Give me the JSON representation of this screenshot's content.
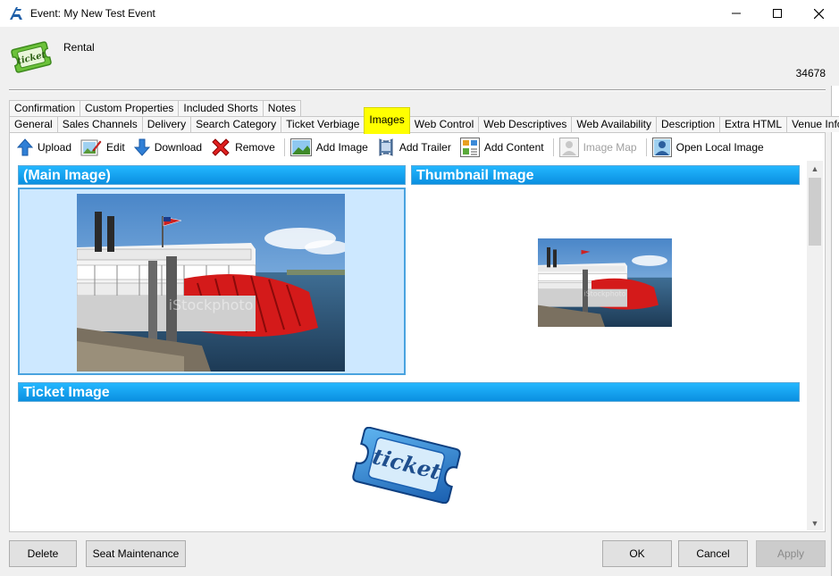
{
  "window": {
    "title": "Event: My New Test Event",
    "controls": {
      "minimize_icon": "minimize-icon",
      "maximize_icon": "maximize-icon",
      "close_icon": "close-icon"
    }
  },
  "header": {
    "type": "Rental",
    "record_id": "34678",
    "icon": "ticket-icon"
  },
  "tabs": {
    "row1": [
      {
        "label": "Confirmation"
      },
      {
        "label": "Custom Properties"
      },
      {
        "label": "Included Shorts"
      },
      {
        "label": "Notes"
      }
    ],
    "row2": [
      {
        "label": "General"
      },
      {
        "label": "Sales Channels"
      },
      {
        "label": "Delivery"
      },
      {
        "label": "Search Category"
      },
      {
        "label": "Ticket Verbiage"
      },
      {
        "label": "Images",
        "active": true
      },
      {
        "label": "Web Control"
      },
      {
        "label": "Web Descriptives"
      },
      {
        "label": "Web Availability"
      },
      {
        "label": "Description"
      },
      {
        "label": "Extra HTML"
      },
      {
        "label": "Venue Info"
      }
    ],
    "active_color": "#ffff00"
  },
  "toolbar": {
    "upload": "Upload",
    "edit": "Edit",
    "download": "Download",
    "remove": "Remove",
    "add_image": "Add Image",
    "add_trailer": "Add Trailer",
    "add_content": "Add Content",
    "image_map": "Image Map",
    "open_local_image": "Open Local Image"
  },
  "images": {
    "main_title": "(Main Image)",
    "thumbnail_title": "Thumbnail Image",
    "ticket_title": "Ticket Image",
    "photo_watermark": "iStockphoto",
    "ticket_word": "ticket",
    "header_color": "#1aa6f0",
    "selected_color": "#cde8ff"
  },
  "footer": {
    "delete": "Delete",
    "seat_maintenance": "Seat Maintenance",
    "ok": "OK",
    "cancel": "Cancel",
    "apply": "Apply"
  }
}
